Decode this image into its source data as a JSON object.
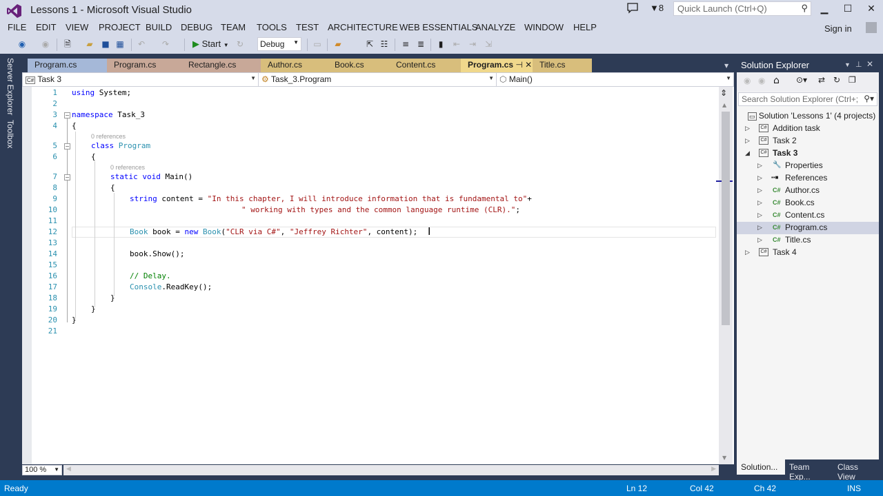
{
  "window": {
    "title": "Lessons 1 - Microsoft Visual Studio",
    "notification_count": "8",
    "quick_launch_placeholder": "Quick Launch (Ctrl+Q)",
    "sign_in": "Sign in"
  },
  "menu": [
    "FILE",
    "EDIT",
    "VIEW",
    "PROJECT",
    "BUILD",
    "DEBUG",
    "TEAM",
    "TOOLS",
    "TEST",
    "ARCHITECTURE",
    "WEB ESSENTIALS",
    "ANALYZE",
    "WINDOW",
    "HELP"
  ],
  "toolbar": {
    "start_label": "Start",
    "configuration": "Debug"
  },
  "side_tabs": [
    "Server Explorer",
    "Toolbox"
  ],
  "doc_tabs": [
    {
      "label": "Program.cs",
      "color": "#a5b8d8"
    },
    {
      "label": "Program.cs",
      "color": "#c8a898"
    },
    {
      "label": "Rectangle.cs",
      "color": "#c8a898"
    },
    {
      "label": "Author.cs",
      "color": "#d8be7c"
    },
    {
      "label": "Book.cs",
      "color": "#d8be7c"
    },
    {
      "label": "Content.cs",
      "color": "#d8be7c"
    },
    {
      "label": "Program.cs",
      "color": "#f0d88c",
      "active": true
    },
    {
      "label": "Title.cs",
      "color": "#d8be7c"
    }
  ],
  "navbar": {
    "project": "Task 3",
    "type": "Task_3.Program",
    "member": "Main()"
  },
  "code": {
    "line_numbers": [
      "1",
      "2",
      "3",
      "4",
      "5",
      "6",
      "7",
      "8",
      "9",
      "10",
      "11",
      "12",
      "13",
      "14",
      "15",
      "16",
      "17",
      "18",
      "19",
      "20",
      "21"
    ],
    "references_label": "0 references",
    "l1_kw": "using",
    "l1_rest": " System;",
    "l3_kw": "namespace",
    "l3_rest": " Task_3",
    "l4": "{",
    "l5_kw": "class",
    "l5_ty": "Program",
    "l6": "{",
    "l7_kw1": "static",
    "l7_kw2": "void",
    "l7_rest": " Main()",
    "l8": "{",
    "l9_kw": "string",
    "l9_rest": " content = ",
    "l9_str": "\"In this chapter, I will introduce information that is fundamental to\"",
    "l9_end": "+",
    "l10_str": "\" working with types and the common language runtime (CLR).\"",
    "l10_end": ";",
    "l12_ty1": "Book",
    "l12_a": " book = ",
    "l12_kw": "new",
    "l12_ty2": "Book",
    "l12_b": "(",
    "l12_s1": "\"CLR via C#\"",
    "l12_c": ", ",
    "l12_s2": "\"Jeffrey Richter\"",
    "l12_d": ", content);",
    "l14": "book.Show();",
    "l16_cm": "// Delay.",
    "l17_ty": "Console",
    "l17_rest": ".ReadKey();",
    "l18": "}",
    "l19": "}",
    "l20": "}"
  },
  "zoom_level": "100 %",
  "solution_explorer": {
    "title": "Solution Explorer",
    "search_placeholder": "Search Solution Explorer (Ctrl+;",
    "solution": "Solution 'Lessons 1' (4 projects)",
    "items": [
      {
        "label": "Addition task",
        "type": "project",
        "expanded": false
      },
      {
        "label": "Task 2",
        "type": "project",
        "expanded": false
      },
      {
        "label": "Task 3",
        "type": "project",
        "expanded": true,
        "bold": true
      },
      {
        "label": "Properties",
        "type": "properties"
      },
      {
        "label": "References",
        "type": "references"
      },
      {
        "label": "Author.cs",
        "type": "file"
      },
      {
        "label": "Book.cs",
        "type": "file"
      },
      {
        "label": "Content.cs",
        "type": "file"
      },
      {
        "label": "Program.cs",
        "type": "file",
        "selected": true
      },
      {
        "label": "Title.cs",
        "type": "file"
      },
      {
        "label": "Task 4",
        "type": "project",
        "expanded": false
      }
    ],
    "bottom_tabs": [
      "Solution...",
      "Team Exp...",
      "Class View"
    ]
  },
  "status": {
    "text": "Ready",
    "line": "Ln 12",
    "col": "Col 42",
    "ch": "Ch 42",
    "mode": "INS"
  }
}
